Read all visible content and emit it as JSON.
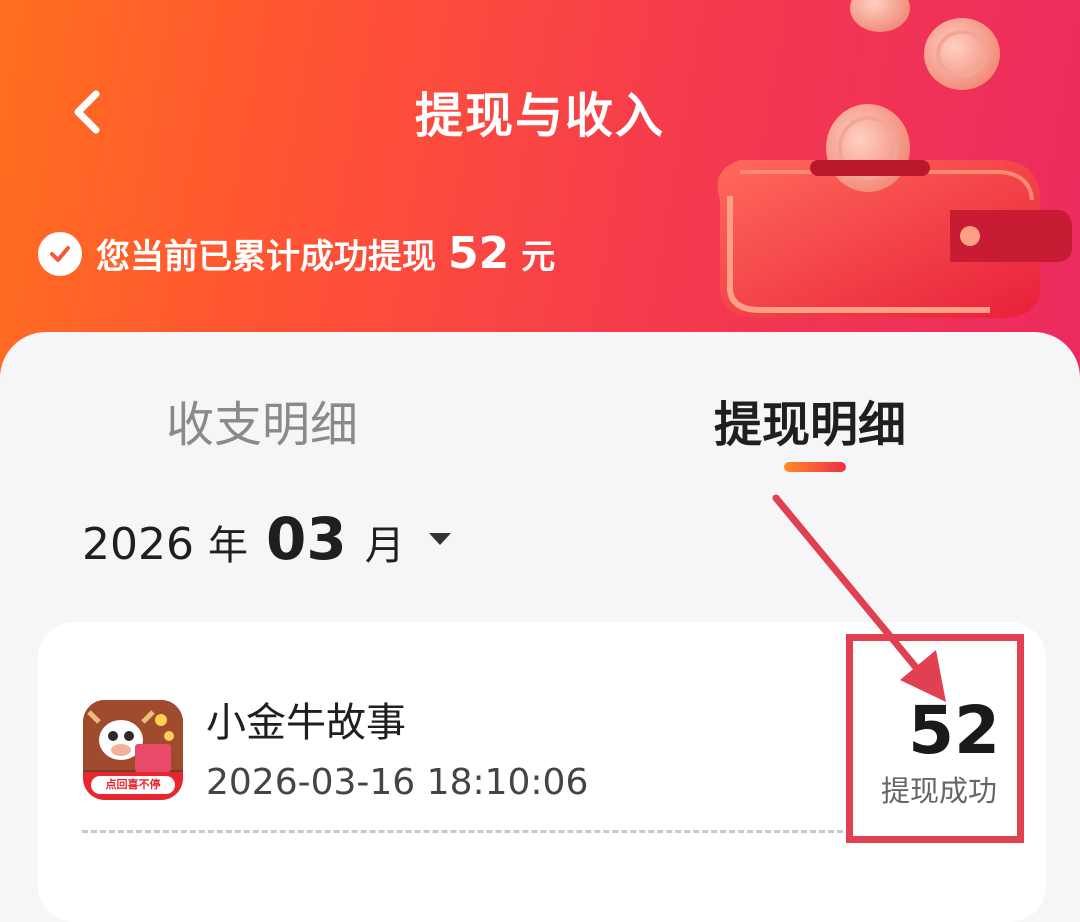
{
  "header": {
    "title": "提现与收入",
    "summary_text": "您当前已累计成功提现",
    "summary_amount": "52",
    "summary_unit": "元"
  },
  "tabs": [
    {
      "label": "收支明细",
      "active": false
    },
    {
      "label": "提现明细",
      "active": true
    }
  ],
  "month_picker": {
    "year": "2026",
    "year_unit": "年",
    "month": "03",
    "month_unit": "月"
  },
  "records": [
    {
      "app_name": "小金牛故事",
      "time": "2026-03-16 18:10:06",
      "amount": "52",
      "status": "提现成功",
      "icon_badge": "点回喜不停"
    }
  ],
  "colors": {
    "header_start": "#ff6f1f",
    "header_end": "#ec2a60",
    "annotation": "#e04050",
    "indicator_start": "#ff8a2a",
    "indicator_end": "#ee2f45"
  },
  "icons": {
    "back": "chevron-left-icon",
    "check": "check-circle-icon",
    "caret": "caret-down-icon",
    "wallet": "wallet-coins-illustration"
  }
}
